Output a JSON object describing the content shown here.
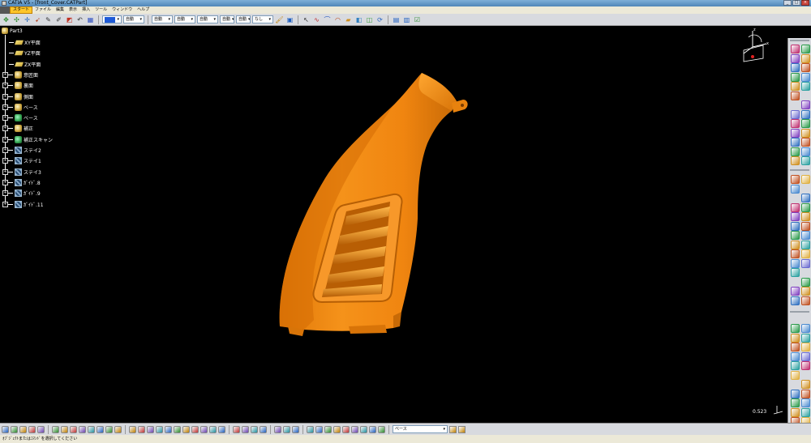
{
  "window": {
    "title": "CATIA V5 - [front_Cover.CATPart]",
    "min": "_",
    "max": "□",
    "close": "×"
  },
  "menu": {
    "items": [
      "スタート",
      "ファイル",
      "編集",
      "表示",
      "挿入",
      "ツール",
      "ウィンドウ",
      "ヘルプ"
    ]
  },
  "toolbar_top": {
    "selects": [
      {
        "value": "自動"
      },
      {
        "value": "自動"
      },
      {
        "value": "自動"
      },
      {
        "value": "自動"
      },
      {
        "value": "自動"
      },
      {
        "value": "自動"
      },
      {
        "value": "なし"
      }
    ],
    "color_swatch": "#1e5ad7"
  },
  "tree": {
    "root": "Part3",
    "items": [
      {
        "label": "XY平面",
        "icon": "plane-icon",
        "expandable": false
      },
      {
        "label": "YZ平面",
        "icon": "plane-icon",
        "expandable": false
      },
      {
        "label": "ZX平面",
        "icon": "plane-icon",
        "expandable": false
      },
      {
        "label": "意匠面",
        "icon": "body-icon",
        "expandable": true
      },
      {
        "label": "裏面",
        "icon": "body-icon",
        "expandable": true
      },
      {
        "label": "側面",
        "icon": "body-icon",
        "expandable": true
      },
      {
        "label": "ベース",
        "icon": "body-icon",
        "expandable": true
      },
      {
        "label": "ベース",
        "icon": "geo-icon",
        "expandable": true
      },
      {
        "label": "補正",
        "icon": "body-icon",
        "expandable": true
      },
      {
        "label": "補正スキャン",
        "icon": "geo-icon",
        "expandable": true
      },
      {
        "label": "ステイ2",
        "icon": "scan-icon",
        "expandable": true
      },
      {
        "label": "ステイ1",
        "icon": "scan-icon",
        "expandable": true
      },
      {
        "label": "ステイ3",
        "icon": "scan-icon",
        "expandable": true
      },
      {
        "label": "ｶﾞｲﾄﾞ.8",
        "icon": "scan-icon",
        "expandable": true
      },
      {
        "label": "ｶﾞｲﾄﾞ.9",
        "icon": "scan-icon",
        "expandable": true
      },
      {
        "label": "ｶﾞｲﾄﾞ.11",
        "icon": "scan-icon",
        "expandable": true
      }
    ]
  },
  "model": {
    "color": "#f08a12",
    "shade": "#b85e04",
    "highlight": "#ffb347"
  },
  "viewer": {
    "zoom": "0.523",
    "compass_labels": {
      "z": "z",
      "x": "x",
      "y": "y"
    }
  },
  "toolbar_bottom": {
    "select_value": "ベース"
  },
  "status": {
    "message": "ｵﾌﾞｼﾞｪｸﾄまたはｺﾏﾝﾄﾞを選択してください"
  }
}
